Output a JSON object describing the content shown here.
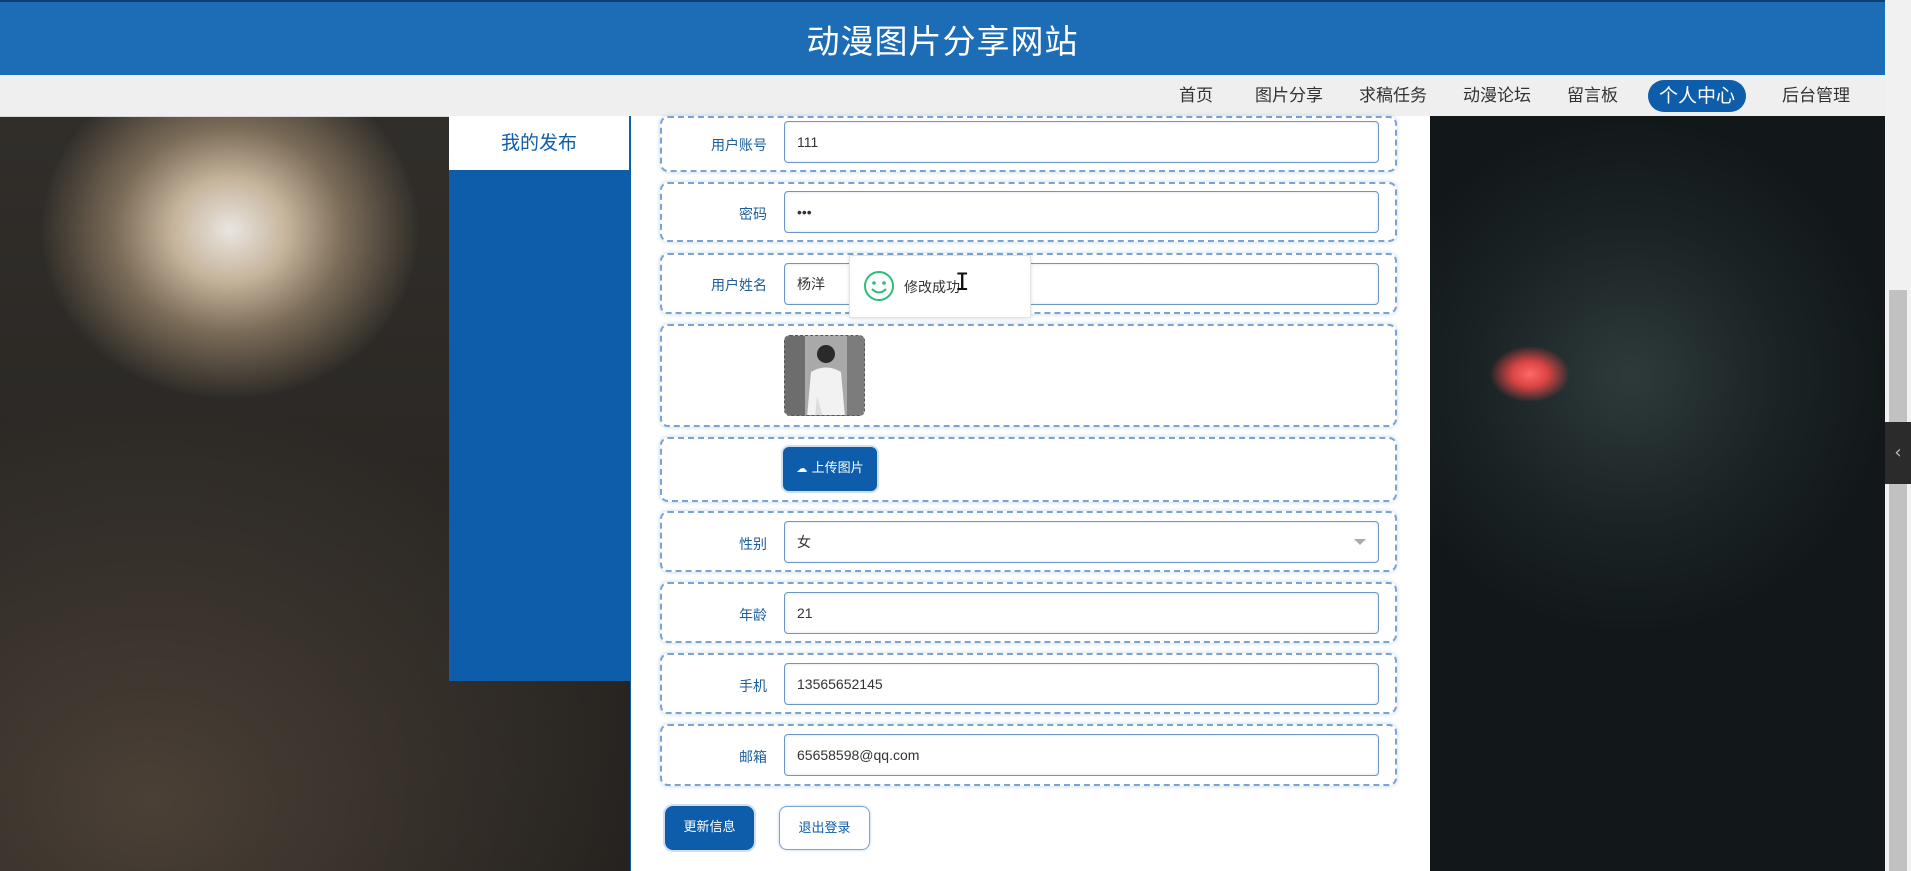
{
  "header": {
    "title": "动漫图片分享网站"
  },
  "nav": {
    "items": [
      {
        "label": "首页"
      },
      {
        "label": "图片分享"
      },
      {
        "label": "求稿任务"
      },
      {
        "label": "动漫论坛"
      },
      {
        "label": "留言板"
      },
      {
        "label": "个人中心",
        "active": true
      },
      {
        "label": "后台管理"
      }
    ]
  },
  "sidebar": {
    "items": [
      {
        "label": "我的发布"
      }
    ]
  },
  "form": {
    "account": {
      "label": "用户账号",
      "value": "111"
    },
    "password": {
      "label": "密码",
      "value": "•••"
    },
    "name": {
      "label": "用户姓名",
      "value": "杨洋"
    },
    "upload_label": "上传图片",
    "gender": {
      "label": "性别",
      "value": "女"
    },
    "age": {
      "label": "年龄",
      "value": "21"
    },
    "phone": {
      "label": "手机",
      "value": "13565652145"
    },
    "email": {
      "label": "邮箱",
      "value": "65658598@qq.com"
    }
  },
  "actions": {
    "update_label": "更新信息",
    "logout_label": "退出登录"
  },
  "toast": {
    "message": "修改成功"
  },
  "colors": {
    "primary": "#0d5dab",
    "header": "#1c6cb6",
    "success": "#2dbd75"
  }
}
